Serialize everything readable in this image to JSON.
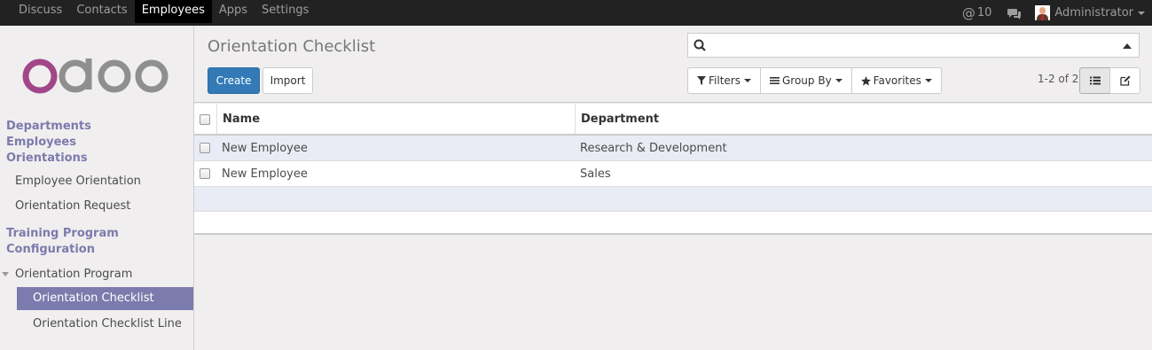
{
  "topbar": {
    "menu": [
      "Discuss",
      "Contacts",
      "Employees",
      "Apps",
      "Settings"
    ],
    "active_menu": "Employees",
    "messages_count": "10",
    "user_name": "Administrator"
  },
  "sidebar": {
    "logo_text": "odoo",
    "departments": "Departments",
    "employees": "Employees",
    "orientations": "Orientations",
    "employee_orientation": "Employee Orientation",
    "orientation_request": "Orientation Request",
    "training_program": "Training Program",
    "configuration": "Configuration",
    "orientation_program": "Orientation Program",
    "orientation_checklist": "Orientation Checklist",
    "orientation_checklist_line": "Orientation Checklist Line"
  },
  "control_panel": {
    "title": "Orientation Checklist",
    "create_label": "Create",
    "import_label": "Import",
    "search_placeholder": "",
    "filters_label": "Filters",
    "groupby_label": "Group By",
    "favorites_label": "Favorites",
    "pager": "1-2 of 2"
  },
  "table": {
    "columns": [
      "Name",
      "Department"
    ],
    "rows": [
      {
        "name": "New Employee",
        "department": "Research & Development"
      },
      {
        "name": "New Employee",
        "department": "Sales"
      }
    ]
  },
  "colors": {
    "topbar_bg": "#222222",
    "accent": "#7c7bad",
    "primary_button": "#337ab7"
  }
}
